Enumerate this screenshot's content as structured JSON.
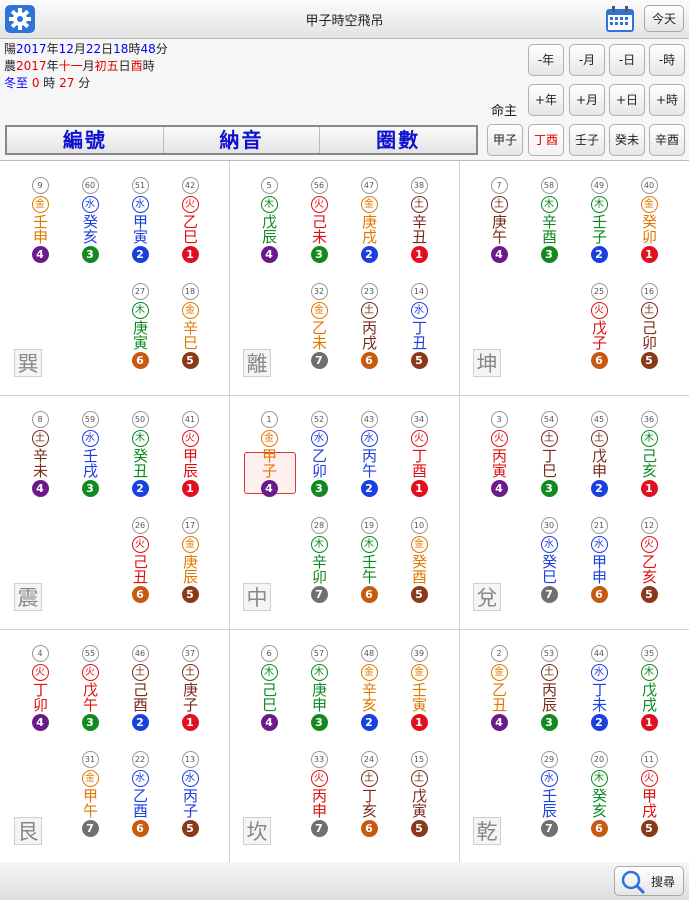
{
  "header": {
    "title": "甲子時空飛吊",
    "today_label": "今天"
  },
  "info": {
    "line1": [
      "陽",
      "2017",
      "年",
      "12",
      "月",
      "22",
      "日",
      "18",
      "時",
      "48",
      "分"
    ],
    "line2": [
      "農",
      "2017",
      "年",
      "十一",
      "月",
      "初五",
      "日",
      "酉",
      "時"
    ],
    "line3": [
      "冬至 ",
      "0",
      " 時 ",
      "27",
      " 分"
    ],
    "mingzhu_label": "命主"
  },
  "banner": [
    "編號",
    "納音",
    "圈數"
  ],
  "buttons": {
    "row1": [
      "-年",
      "-月",
      "-日",
      "-時"
    ],
    "row2": [
      "+年",
      "+月",
      "+日",
      "+時"
    ],
    "row3": [
      "甲子",
      "丁酉",
      "壬子",
      "癸未",
      "辛酉"
    ],
    "row3_active": 1
  },
  "search_label": "搜尋",
  "colors": {
    "elements": {
      "金": "#e07800",
      "水": "#1a3fe0",
      "木": "#0a8a20",
      "火": "#e01010",
      "土": "#7a2a1a"
    },
    "rings": {
      "1": "#e01020",
      "2": "#1a40e0",
      "3": "#138a20",
      "4": "#6a1a8a",
      "5": "#8a3a1a",
      "6": "#c85a10",
      "7": "#707070"
    }
  },
  "palaces": [
    {
      "name": "巽",
      "stars": [
        {
          "num": "9",
          "el": "金",
          "gz": "壬申",
          "ring": "4"
        },
        {
          "num": "60",
          "el": "水",
          "gz": "癸亥",
          "ring": "3"
        },
        {
          "num": "51",
          "el": "水",
          "gz": "甲寅",
          "ring": "2"
        },
        {
          "num": "42",
          "el": "火",
          "gz": "乙巳",
          "ring": "1"
        },
        {
          "num": "27",
          "el": "木",
          "gz": "庚寅",
          "ring": "6"
        },
        {
          "num": "18",
          "el": "金",
          "gz": "辛巳",
          "ring": "5"
        }
      ]
    },
    {
      "name": "離",
      "stars": [
        {
          "num": "5",
          "el": "木",
          "gz": "戊辰",
          "ring": "4"
        },
        {
          "num": "56",
          "el": "火",
          "gz": "己未",
          "ring": "3"
        },
        {
          "num": "47",
          "el": "金",
          "gz": "庚戌",
          "ring": "2"
        },
        {
          "num": "38",
          "el": "土",
          "gz": "辛丑",
          "ring": "1"
        },
        {
          "num": "32",
          "el": "金",
          "gz": "乙未",
          "ring": "7"
        },
        {
          "num": "23",
          "el": "土",
          "gz": "丙戌",
          "ring": "6"
        },
        {
          "num": "14",
          "el": "水",
          "gz": "丁丑",
          "ring": "5"
        }
      ]
    },
    {
      "name": "坤",
      "stars": [
        {
          "num": "7",
          "el": "土",
          "gz": "庚午",
          "ring": "4"
        },
        {
          "num": "58",
          "el": "木",
          "gz": "辛酉",
          "ring": "3"
        },
        {
          "num": "49",
          "el": "木",
          "gz": "壬子",
          "ring": "2"
        },
        {
          "num": "40",
          "el": "金",
          "gz": "癸卯",
          "ring": "1"
        },
        {
          "num": "25",
          "el": "火",
          "gz": "戊子",
          "ring": "6"
        },
        {
          "num": "16",
          "el": "土",
          "gz": "己卯",
          "ring": "5"
        }
      ]
    },
    {
      "name": "震",
      "stars": [
        {
          "num": "8",
          "el": "土",
          "gz": "辛未",
          "ring": "4"
        },
        {
          "num": "59",
          "el": "水",
          "gz": "壬戌",
          "ring": "3"
        },
        {
          "num": "50",
          "el": "木",
          "gz": "癸丑",
          "ring": "2"
        },
        {
          "num": "41",
          "el": "火",
          "gz": "甲辰",
          "ring": "1"
        },
        {
          "num": "26",
          "el": "火",
          "gz": "己丑",
          "ring": "6"
        },
        {
          "num": "17",
          "el": "金",
          "gz": "庚辰",
          "ring": "5"
        }
      ]
    },
    {
      "name": "中",
      "highlight": true,
      "stars": [
        {
          "num": "1",
          "el": "金",
          "gz": "甲子",
          "ring": "4"
        },
        {
          "num": "52",
          "el": "水",
          "gz": "乙卯",
          "ring": "3"
        },
        {
          "num": "43",
          "el": "水",
          "gz": "丙午",
          "ring": "2"
        },
        {
          "num": "34",
          "el": "火",
          "gz": "丁酉",
          "ring": "1"
        },
        {
          "num": "28",
          "el": "木",
          "gz": "辛卯",
          "ring": "7"
        },
        {
          "num": "19",
          "el": "木",
          "gz": "壬午",
          "ring": "6"
        },
        {
          "num": "10",
          "el": "金",
          "gz": "癸酉",
          "ring": "5"
        }
      ]
    },
    {
      "name": "兌",
      "stars": [
        {
          "num": "3",
          "el": "火",
          "gz": "丙寅",
          "ring": "4"
        },
        {
          "num": "54",
          "el": "土",
          "gz": "丁巳",
          "ring": "3"
        },
        {
          "num": "45",
          "el": "土",
          "gz": "戊申",
          "ring": "2"
        },
        {
          "num": "36",
          "el": "木",
          "gz": "己亥",
          "ring": "1"
        },
        {
          "num": "30",
          "el": "水",
          "gz": "癸巳",
          "ring": "7"
        },
        {
          "num": "21",
          "el": "水",
          "gz": "甲申",
          "ring": "6"
        },
        {
          "num": "12",
          "el": "火",
          "gz": "乙亥",
          "ring": "5"
        }
      ]
    },
    {
      "name": "艮",
      "stars": [
        {
          "num": "4",
          "el": "火",
          "gz": "丁卯",
          "ring": "4"
        },
        {
          "num": "55",
          "el": "火",
          "gz": "戊午",
          "ring": "3"
        },
        {
          "num": "46",
          "el": "土",
          "gz": "己酉",
          "ring": "2"
        },
        {
          "num": "37",
          "el": "土",
          "gz": "庚子",
          "ring": "1"
        },
        {
          "num": "31",
          "el": "金",
          "gz": "甲午",
          "ring": "7"
        },
        {
          "num": "22",
          "el": "水",
          "gz": "乙酉",
          "ring": "6"
        },
        {
          "num": "13",
          "el": "水",
          "gz": "丙子",
          "ring": "5"
        }
      ]
    },
    {
      "name": "坎",
      "stars": [
        {
          "num": "6",
          "el": "木",
          "gz": "己巳",
          "ring": "4"
        },
        {
          "num": "57",
          "el": "木",
          "gz": "庚申",
          "ring": "3"
        },
        {
          "num": "48",
          "el": "金",
          "gz": "辛亥",
          "ring": "2"
        },
        {
          "num": "39",
          "el": "金",
          "gz": "壬寅",
          "ring": "1"
        },
        {
          "num": "33",
          "el": "火",
          "gz": "丙申",
          "ring": "7"
        },
        {
          "num": "24",
          "el": "土",
          "gz": "丁亥",
          "ring": "6"
        },
        {
          "num": "15",
          "el": "土",
          "gz": "戊寅",
          "ring": "5"
        }
      ]
    },
    {
      "name": "乾",
      "stars": [
        {
          "num": "2",
          "el": "金",
          "gz": "乙丑",
          "ring": "4"
        },
        {
          "num": "53",
          "el": "土",
          "gz": "丙辰",
          "ring": "3"
        },
        {
          "num": "44",
          "el": "水",
          "gz": "丁未",
          "ring": "2"
        },
        {
          "num": "35",
          "el": "木",
          "gz": "戊戌",
          "ring": "1"
        },
        {
          "num": "29",
          "el": "水",
          "gz": "壬辰",
          "ring": "7"
        },
        {
          "num": "20",
          "el": "木",
          "gz": "癸亥",
          "ring": "6"
        },
        {
          "num": "11",
          "el": "火",
          "gz": "甲戌",
          "ring": "5"
        }
      ]
    }
  ]
}
